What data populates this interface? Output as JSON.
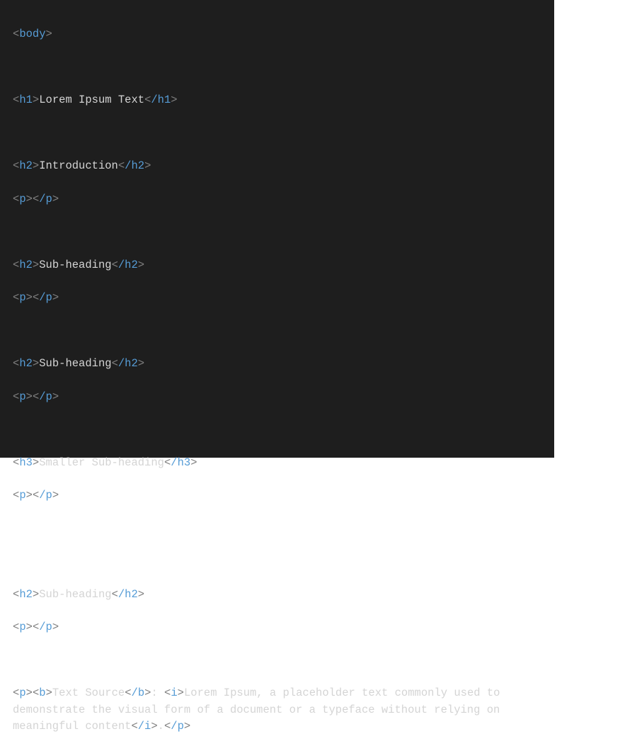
{
  "code": {
    "tags": {
      "body_open": "body",
      "h1_open": "h1",
      "h1_close": "/h1",
      "h2_open": "h2",
      "h2_close": "/h2",
      "h3_open": "h3",
      "h3_close": "/h3",
      "p_open": "p",
      "p_close": "/p",
      "b_open": "b",
      "b_close": "/b",
      "i_open": "i",
      "i_close": "/i"
    },
    "content": {
      "h1_text": "Lorem Ipsum Text",
      "h2_intro": "Introduction",
      "h2_sub1": "Sub-heading",
      "h2_sub2": "Sub-heading",
      "h3_small": "Smaller Sub-heading",
      "h2_sub3": "Sub-heading",
      "source_label": "Text Source",
      "source_sep": ": ",
      "source_italic": "Lorem Ipsum, a placeholder text commonly used to demonstrate the visual form of a document or a typeface without relying on meaningful content",
      "source_end": "."
    },
    "brackets": {
      "lt": "<",
      "gt": ">"
    }
  }
}
